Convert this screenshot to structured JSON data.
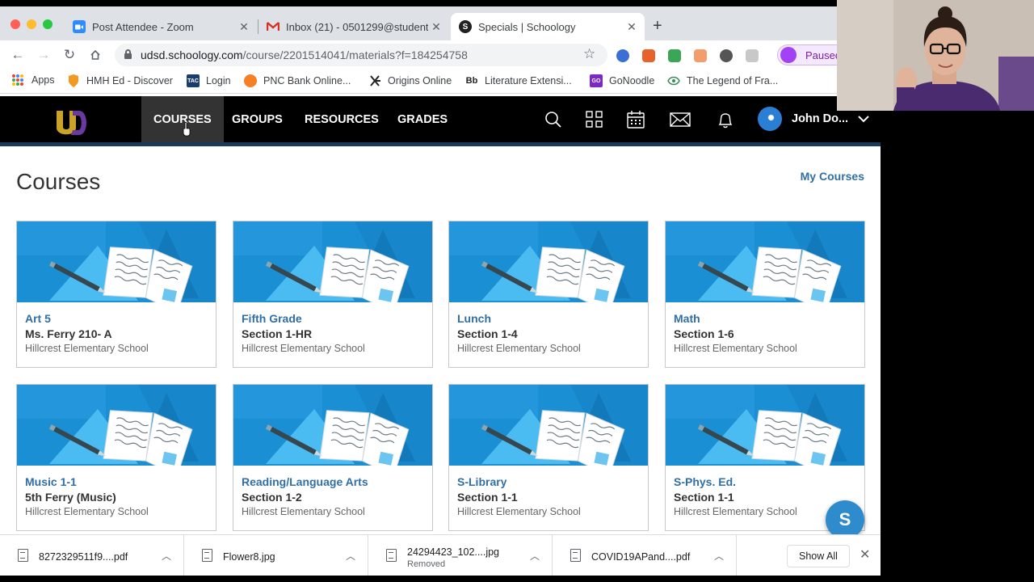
{
  "browser": {
    "tabs": [
      {
        "title": "Post Attendee - Zoom",
        "icon": "zoom-icon",
        "color": "#2d8cff"
      },
      {
        "title": "Inbox (21) - 0501299@student",
        "icon": "gmail-icon",
        "color": "#d93025"
      },
      {
        "title": "Specials | Schoology",
        "icon": "schoology-icon",
        "color": "#202124"
      }
    ],
    "address": {
      "host": "udsd.schoology.com",
      "path": "/course/2201514041/materials?f=184254758"
    },
    "profile_label": "Paused",
    "bookmarks": [
      {
        "label": "Apps",
        "icon": "apps-icon"
      },
      {
        "label": "HMH Ed - Discover",
        "icon": "hmh-shield-icon"
      },
      {
        "label": "Login",
        "icon": "tac-icon",
        "badge": "TAC"
      },
      {
        "label": "PNC Bank Online...",
        "icon": "pnc-icon"
      },
      {
        "label": "Origins Online",
        "icon": "origins-icon"
      },
      {
        "label": "Literature Extensi...",
        "icon": "blackboard-icon",
        "badge": "Bb"
      },
      {
        "label": "GoNoodle",
        "icon": "gonoodle-icon",
        "badge": "GO"
      },
      {
        "label": "The Legend of Fra...",
        "icon": "legend-icon"
      }
    ]
  },
  "nav": {
    "links": [
      "COURSES",
      "GROUPS",
      "RESOURCES",
      "GRADES"
    ],
    "active": "COURSES",
    "user": "John Do..."
  },
  "page": {
    "title": "Courses",
    "my_courses_link": "My Courses"
  },
  "courses": [
    {
      "name": "Art 5",
      "section": "Ms. Ferry 210- A",
      "school": "Hillcrest Elementary School"
    },
    {
      "name": "Fifth Grade",
      "section": "Section 1-HR",
      "school": "Hillcrest Elementary School"
    },
    {
      "name": "Lunch",
      "section": "Section 1-4",
      "school": "Hillcrest Elementary School"
    },
    {
      "name": "Math",
      "section": "Section 1-6",
      "school": "Hillcrest Elementary School"
    },
    {
      "name": "Music 1-1",
      "section": "5th Ferry (Music)",
      "school": "Hillcrest Elementary School"
    },
    {
      "name": "Reading/Language Arts",
      "section": "Section 1-2",
      "school": "Hillcrest Elementary School"
    },
    {
      "name": "S-Library",
      "section": "Section 1-1",
      "school": "Hillcrest Elementary School"
    },
    {
      "name": "S-Phys. Ed.",
      "section": "Section 1-1",
      "school": "Hillcrest Elementary School"
    }
  ],
  "chat_bubble": "S",
  "downloads": {
    "items": [
      {
        "filename": "8272329511f9....pdf",
        "status": ""
      },
      {
        "filename": "Flower8.jpg",
        "status": ""
      },
      {
        "filename": "24294423_102....jpg",
        "status": "Removed"
      },
      {
        "filename": "COVID19APand....pdf",
        "status": ""
      }
    ],
    "show_all": "Show All"
  },
  "colors": {
    "accent_link": "#2f6fa5",
    "nav_bg": "#000000",
    "card_blue": "#1a8fd4"
  }
}
